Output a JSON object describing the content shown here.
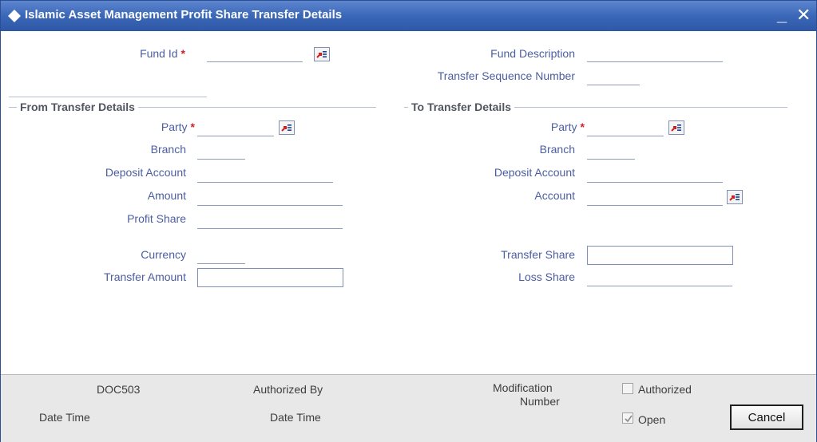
{
  "window": {
    "title": "Islamic Asset Management Profit Share Transfer Details",
    "minimize_label": "_",
    "close_label": "✕",
    "title_bar_color": "#3b67b8"
  },
  "header": {
    "fund_id_label": "Fund Id",
    "fund_id_value": "",
    "fund_description_label": "Fund Description",
    "fund_description_value": "",
    "transfer_seq_label": "Transfer Sequence Number",
    "transfer_seq_value": ""
  },
  "required_marker": "*",
  "from_section": {
    "title": "From Transfer Details",
    "party_label": "Party",
    "party_value": "",
    "branch_label": "Branch",
    "branch_value": "",
    "deposit_account_label": "Deposit Account",
    "deposit_account_value": "",
    "amount_label": "Amount",
    "amount_value": "",
    "profit_share_label": "Profit Share",
    "profit_share_value": "",
    "currency_label": "Currency",
    "currency_value": "",
    "transfer_amount_label": "Transfer Amount",
    "transfer_amount_value": ""
  },
  "to_section": {
    "title": "To Transfer Details",
    "party_label": "Party",
    "party_value": "",
    "branch_label": "Branch",
    "branch_value": "",
    "deposit_account_label": "Deposit Account",
    "deposit_account_value": "",
    "account_label": "Account",
    "account_value": "",
    "transfer_share_label": "Transfer Share",
    "transfer_share_value": "",
    "loss_share_label": "Loss Share",
    "loss_share_value": ""
  },
  "footer": {
    "maker_id": "DOC503",
    "maker_date_time_label": "Date Time",
    "authorized_by_label": "Authorized By",
    "checker_date_time_label": "Date Time",
    "modification_label_line1": "Modification",
    "modification_label_line2": "Number",
    "authorized_checkbox_label": "Authorized",
    "authorized_checked": false,
    "open_checkbox_label": "Open",
    "open_checked": true,
    "cancel_button_label": "Cancel"
  },
  "colors": {
    "label_text": "#4b5ea0",
    "required_star": "#d0202a",
    "footer_bg": "#e8e8e8"
  }
}
